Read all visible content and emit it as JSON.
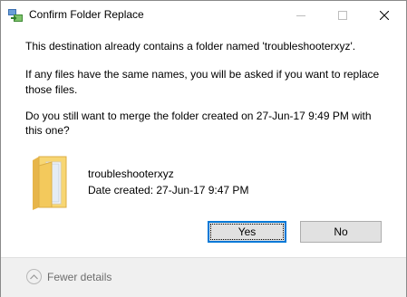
{
  "window": {
    "title": "Confirm Folder Replace",
    "controls": {
      "minimize": "minimize-icon",
      "maximize": "maximize-icon",
      "close": "close-icon"
    }
  },
  "message": {
    "line1": "This destination already contains a folder named 'troubleshooterxyz'.",
    "line2a": "If any files have the same names, you will be asked if you want to replace",
    "line2b": "those files.",
    "line3a": "Do you still want to merge the folder created on 27-Jun-17 9:49 PM with",
    "line3b": "this one?"
  },
  "item": {
    "icon": "folder-icon",
    "name": "troubleshooterxyz",
    "date": "Date created: 27-Jun-17 9:47 PM"
  },
  "buttons": {
    "yes": "Yes",
    "no": "No"
  },
  "footer": {
    "toggle_icon": "chevron-up-icon",
    "label": "Fewer details"
  },
  "colors": {
    "accent": "#0078d7",
    "footer_bg": "#f0f0f0",
    "button_bg": "#e1e1e1"
  }
}
